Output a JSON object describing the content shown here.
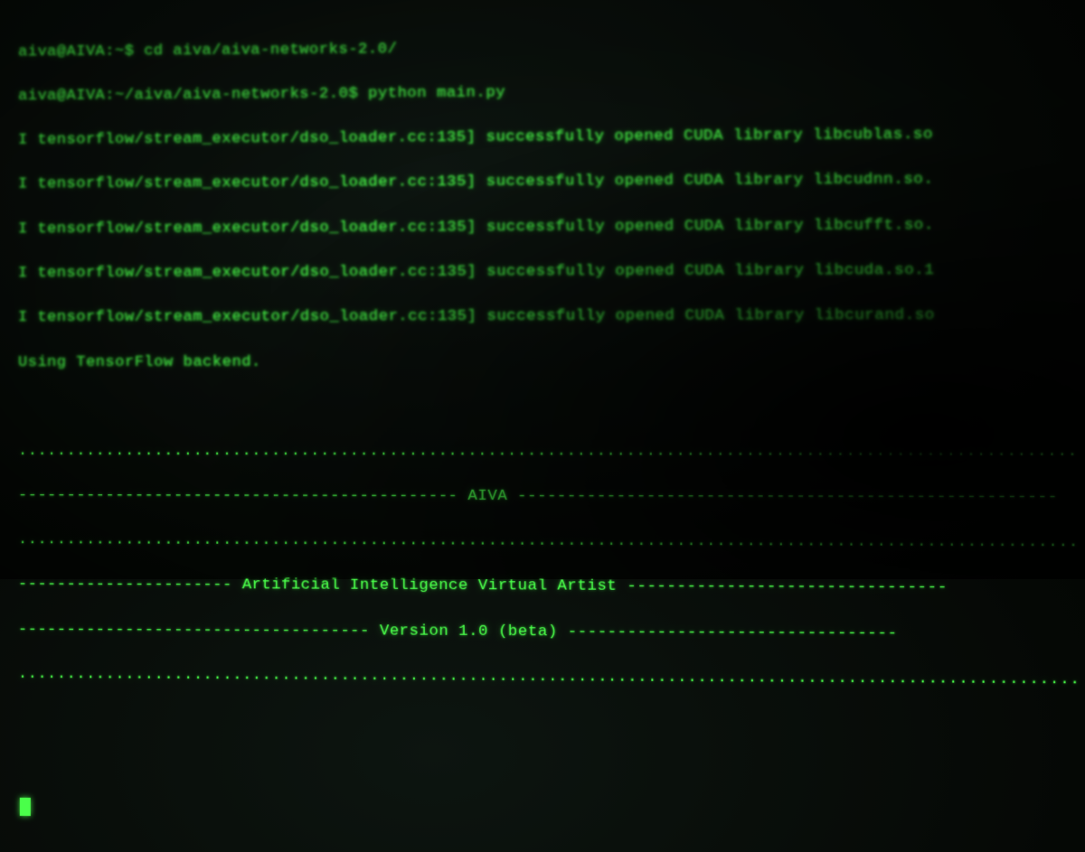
{
  "prompt1": {
    "user_host": "aiva@AIVA",
    "path": "~",
    "symbol": "$",
    "command": "cd aiva/aiva-networks-2.0/"
  },
  "prompt2": {
    "user_host": "aiva@AIVA",
    "path": "~/aiva/aiva-networks-2.0",
    "symbol": "$",
    "command": "python main.py"
  },
  "cuda_lines": [
    "I tensorflow/stream_executor/dso_loader.cc:135] successfully opened CUDA library libcublas.so",
    "I tensorflow/stream_executor/dso_loader.cc:135] successfully opened CUDA library libcudnn.so.",
    "I tensorflow/stream_executor/dso_loader.cc:135] successfully opened CUDA library libcufft.so.",
    "I tensorflow/stream_executor/dso_loader.cc:135] successfully opened CUDA library libcuda.so.1",
    "I tensorflow/stream_executor/dso_loader.cc:135] successfully opened CUDA library libcurand.so"
  ],
  "backend_line": "Using TensorFlow backend.",
  "banner": {
    "dots_full": "...........................................................................................................",
    "title_line": "--------------------------------------------- AIVA ------------------------------------------------------",
    "subtitle_line": "---------------------- Artificial Intelligence Virtual Artist --------------------------------",
    "version_line": "------------------------------------ Version 1.0 (beta) ---------------------------------"
  }
}
